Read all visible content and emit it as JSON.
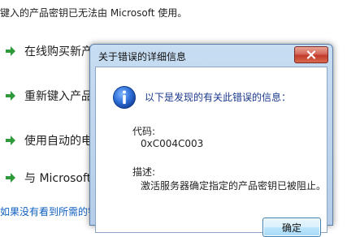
{
  "background": {
    "header_text": "键入的产品密钥已无法由 Microsoft 使用。",
    "options": [
      {
        "label": "在线购买新产品密钥(P)"
      },
      {
        "label": "重新键入产品密"
      },
      {
        "label": "使用自动的电话"
      },
      {
        "label": "与 Microsoft 联"
      }
    ],
    "footer_link": "如果没有看到所需的错误消息"
  },
  "dialog": {
    "title": "关于错误的详细信息",
    "close_icon": "close-icon",
    "message": "以下是发现的有关此错误的信息：",
    "code_label": "代码:",
    "code_value": "0xC004C003",
    "desc_label": "描述:",
    "desc_value": "激活服务器确定指定的产品密钥已被阻止。",
    "ok_label": "确定"
  },
  "colors": {
    "arrow_green": "#2e9a3a",
    "title_bar": "#bcd4ed",
    "close_red": "#c7412f",
    "message_blue": "#1b3a8c"
  }
}
